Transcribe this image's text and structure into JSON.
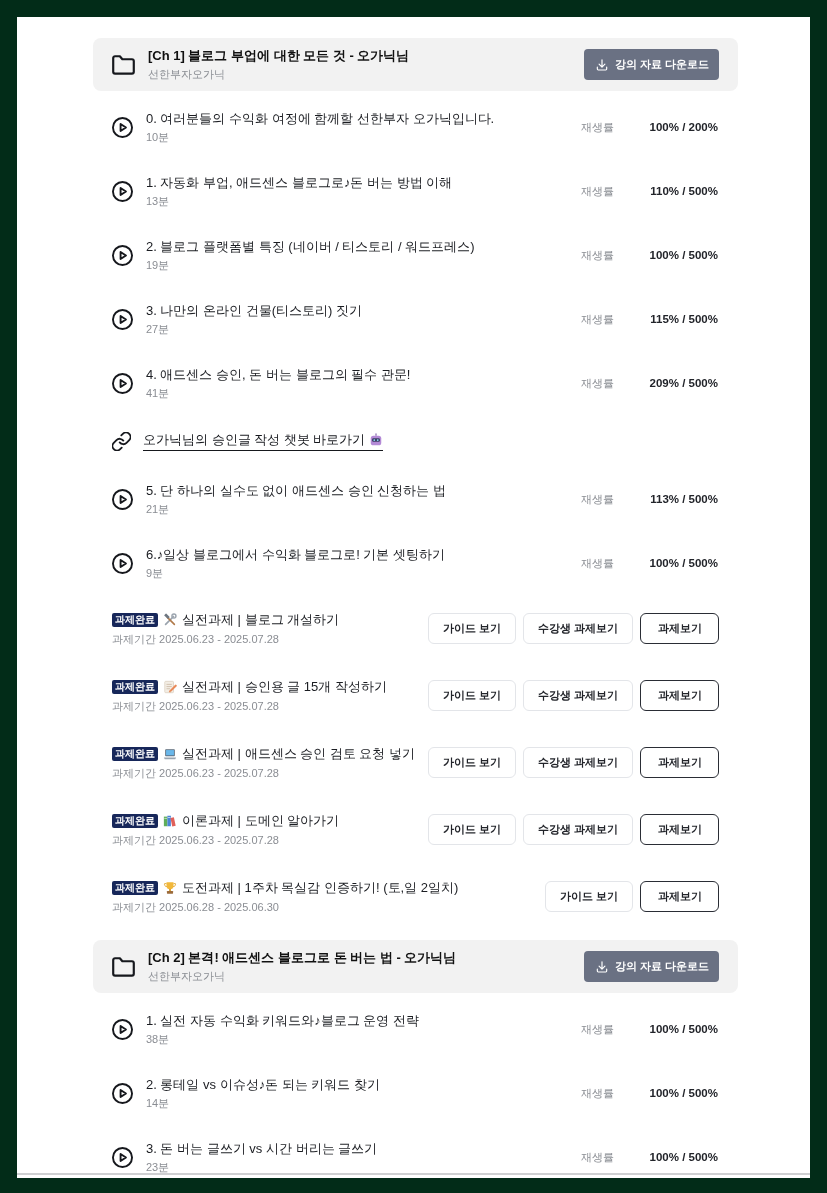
{
  "chapters": [
    {
      "title": "[Ch 1] 블로그 부업에 대한 모든 것 - 오가닉님",
      "instructor": "선한부자오가닉",
      "download_button": "강의 자료 다운로드",
      "items": [
        {
          "kind": "lecture",
          "title": "0. 여러분들의 수익화 여정에 함께할 선한부자 오가닉입니다.",
          "duration": "10분",
          "progress_label": "재생률",
          "progress": "100% / 200%"
        },
        {
          "kind": "lecture",
          "title": "1. 자동화 부업, 애드센스 블로그로♪돈 버는 방법 이해",
          "duration": "13분",
          "progress_label": "재생률",
          "progress": "110% / 500%"
        },
        {
          "kind": "lecture",
          "title": "2. 블로그 플랫폼별 특징 (네이버 / 티스토리 / 워드프레스)",
          "duration": "19분",
          "progress_label": "재생률",
          "progress": "100% / 500%"
        },
        {
          "kind": "lecture",
          "title": "3. 나만의 온라인 건물(티스토리) 짓기",
          "duration": "27분",
          "progress_label": "재생률",
          "progress": "115% / 500%"
        },
        {
          "kind": "lecture",
          "title": "4. 애드센스 승인, 돈 버는 블로그의 필수 관문!",
          "duration": "41분",
          "progress_label": "재생률",
          "progress": "209% / 500%"
        },
        {
          "kind": "link",
          "label": "오가닉님의 승인글 작성 챗봇 바로가기"
        },
        {
          "kind": "lecture",
          "title": "5. 단 하나의 실수도 없이 애드센스 승인 신청하는 법",
          "duration": "21분",
          "progress_label": "재생률",
          "progress": "113% / 500%"
        },
        {
          "kind": "lecture",
          "title": "6.♪일상 블로그에서 수익화 블로그로! 기본 셋팅하기",
          "duration": "9분",
          "progress_label": "재생률",
          "progress": "100% / 500%"
        },
        {
          "kind": "assignment",
          "status": "과제완료",
          "title": "실전과제 | 블로그 개설하기",
          "period": "과제기간 2025.06.23 - 2025.07.28",
          "buttons": [
            {
              "kind": "guide",
              "label": "가이드 보기"
            },
            {
              "kind": "submissions",
              "label": "수강생 과제보기"
            },
            {
              "kind": "assignment",
              "label": "과제보기"
            }
          ]
        },
        {
          "kind": "assignment",
          "status": "과제완료",
          "title": "실전과제 | 승인용 글 15개 작성하기",
          "period": "과제기간 2025.06.23 - 2025.07.28",
          "buttons": [
            {
              "kind": "guide",
              "label": "가이드 보기"
            },
            {
              "kind": "submissions",
              "label": "수강생 과제보기"
            },
            {
              "kind": "assignment",
              "label": "과제보기"
            }
          ]
        },
        {
          "kind": "assignment",
          "status": "과제완료",
          "title": "실전과제 | 애드센스 승인 검토 요청 넣기",
          "period": "과제기간 2025.06.23 - 2025.07.28",
          "buttons": [
            {
              "kind": "guide",
              "label": "가이드 보기"
            },
            {
              "kind": "submissions",
              "label": "수강생 과제보기"
            },
            {
              "kind": "assignment",
              "label": "과제보기"
            }
          ]
        },
        {
          "kind": "assignment",
          "status": "과제완료",
          "title": "이론과제 | 도메인 알아가기",
          "period": "과제기간 2025.06.23 - 2025.07.28",
          "buttons": [
            {
              "kind": "guide",
              "label": "가이드 보기"
            },
            {
              "kind": "submissions",
              "label": "수강생 과제보기"
            },
            {
              "kind": "assignment",
              "label": "과제보기"
            }
          ]
        },
        {
          "kind": "assignment",
          "status": "과제완료",
          "title": "도전과제 | 1주차 목실감 인증하기! (토,일 2일치)",
          "period": "과제기간 2025.06.28 - 2025.06.30",
          "buttons": [
            {
              "kind": "guide",
              "label": "가이드 보기"
            },
            {
              "kind": "assignment",
              "label": "과제보기"
            }
          ]
        }
      ]
    },
    {
      "title": "[Ch 2] 본격! 애드센스 블로그로 돈 버는 법 - 오가닉님",
      "instructor": "선한부자오가닉",
      "download_button": "강의 자료 다운로드",
      "items": [
        {
          "kind": "lecture",
          "title": "1. 실전 자동 수익화 키워드와♪블로그 운영 전략",
          "duration": "38분",
          "progress_label": "재생률",
          "progress": "100% / 500%"
        },
        {
          "kind": "lecture",
          "title": "2. 롱테일 vs 이슈성♪돈 되는 키워드 찾기",
          "duration": "14분",
          "progress_label": "재생률",
          "progress": "100% / 500%"
        },
        {
          "kind": "lecture",
          "title": "3. 돈 버는 글쓰기 vs 시간 버리는 글쓰기",
          "duration": "23분",
          "progress_label": "재생률",
          "progress": "100% / 500%"
        }
      ]
    }
  ]
}
